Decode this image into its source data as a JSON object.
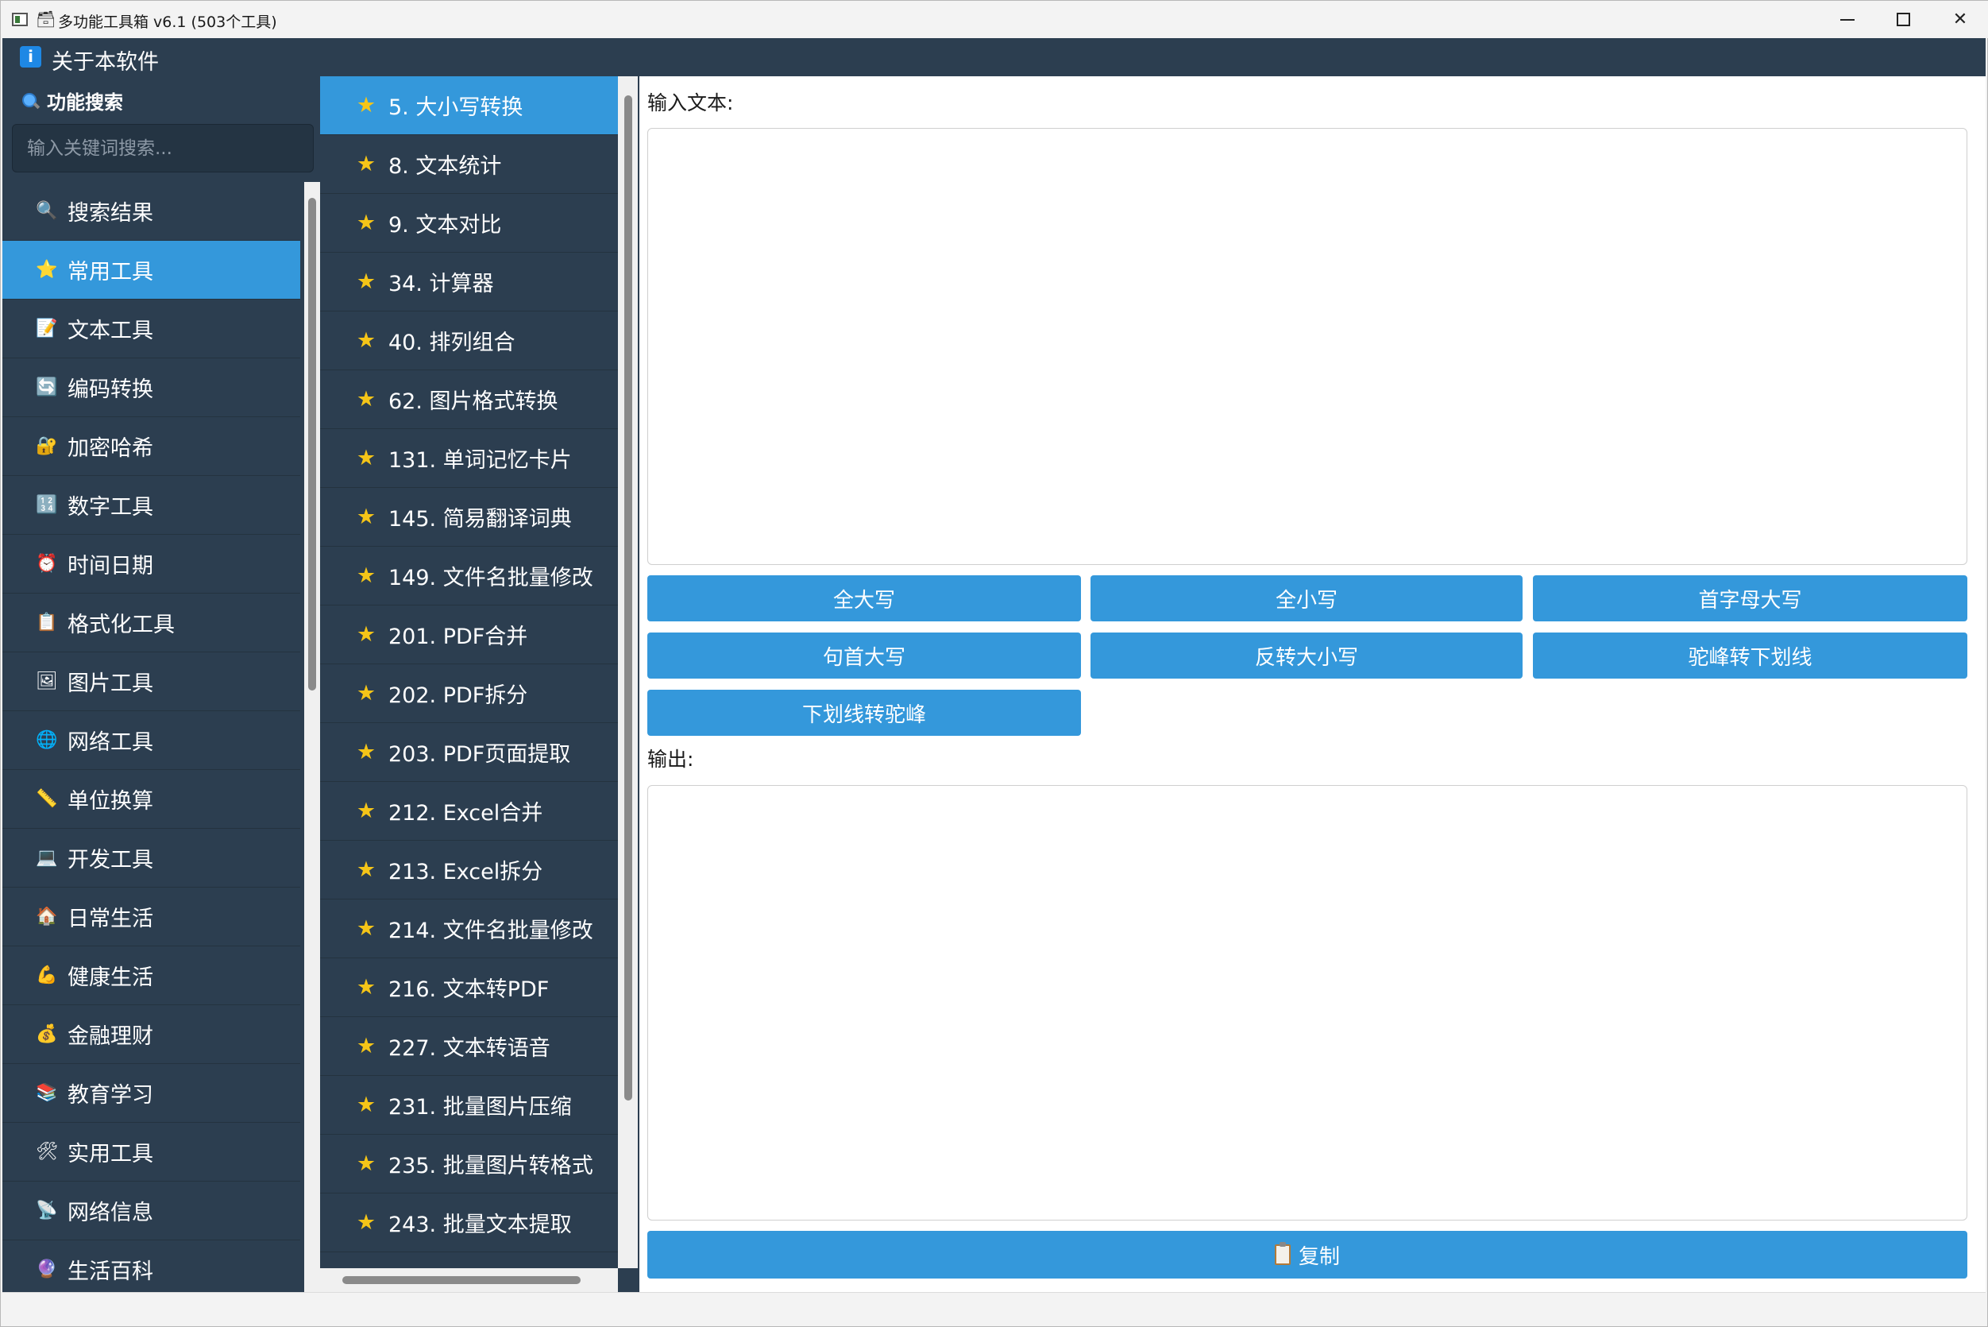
{
  "window": {
    "title_glyph": "🗃",
    "title": "多功能工具箱 v6.1 (503个工具)",
    "close_glyph": "✕"
  },
  "menu": {
    "about_label": "关于本软件",
    "about_icon": "i"
  },
  "sidebar": {
    "search_heading": "功能搜索",
    "search_placeholder": "输入关键词搜索...",
    "categories": [
      {
        "label": "搜索结果",
        "icon": "🔍"
      },
      {
        "label": "常用工具",
        "icon": "⭐",
        "active": true
      },
      {
        "label": "文本工具",
        "icon": "📝"
      },
      {
        "label": "编码转换",
        "icon": "🔄"
      },
      {
        "label": "加密哈希",
        "icon": "🔐"
      },
      {
        "label": "数字工具",
        "icon": "🔢"
      },
      {
        "label": "时间日期",
        "icon": "⏰"
      },
      {
        "label": "格式化工具",
        "icon": "📋"
      },
      {
        "label": "图片工具",
        "icon": "🖼"
      },
      {
        "label": "网络工具",
        "icon": "🌐"
      },
      {
        "label": "单位换算",
        "icon": "📏"
      },
      {
        "label": "开发工具",
        "icon": "💻"
      },
      {
        "label": "日常生活",
        "icon": "🏠"
      },
      {
        "label": "健康生活",
        "icon": "💪"
      },
      {
        "label": "金融理财",
        "icon": "💰"
      },
      {
        "label": "教育学习",
        "icon": "📚"
      },
      {
        "label": "实用工具",
        "icon": "🛠"
      },
      {
        "label": "网络信息",
        "icon": "📡"
      },
      {
        "label": "生活百科",
        "icon": "🔮"
      }
    ]
  },
  "tools": {
    "star_icon": "★",
    "items": [
      {
        "label": "5. 大小写转换",
        "active": true
      },
      {
        "label": "8. 文本统计"
      },
      {
        "label": "9. 文本对比"
      },
      {
        "label": "34. 计算器"
      },
      {
        "label": "40. 排列组合"
      },
      {
        "label": "62. 图片格式转换"
      },
      {
        "label": "131. 单词记忆卡片"
      },
      {
        "label": "145. 简易翻译词典"
      },
      {
        "label": "149. 文件名批量修改"
      },
      {
        "label": "201. PDF合并"
      },
      {
        "label": "202. PDF拆分"
      },
      {
        "label": "203. PDF页面提取"
      },
      {
        "label": "212. Excel合并"
      },
      {
        "label": "213. Excel拆分"
      },
      {
        "label": "214. 文件名批量修改"
      },
      {
        "label": "216. 文本转PDF"
      },
      {
        "label": "227. 文本转语音"
      },
      {
        "label": "231. 批量图片压缩"
      },
      {
        "label": "235. 批量图片转格式"
      },
      {
        "label": "243. 批量文本提取"
      }
    ]
  },
  "main": {
    "input_label": "输入文本:",
    "output_label": "输出:",
    "buttons": {
      "upper": "全大写",
      "lower": "全小写",
      "capitalize": "首字母大写",
      "sentence": "句首大写",
      "swap": "反转大小写",
      "camel_to_snake": "驼峰转下划线",
      "snake_to_camel": "下划线转驼峰",
      "copy": "复制"
    }
  },
  "colors": {
    "sidebar_bg": "#2c3e50",
    "accent": "#3498db",
    "star": "#f5c518"
  }
}
